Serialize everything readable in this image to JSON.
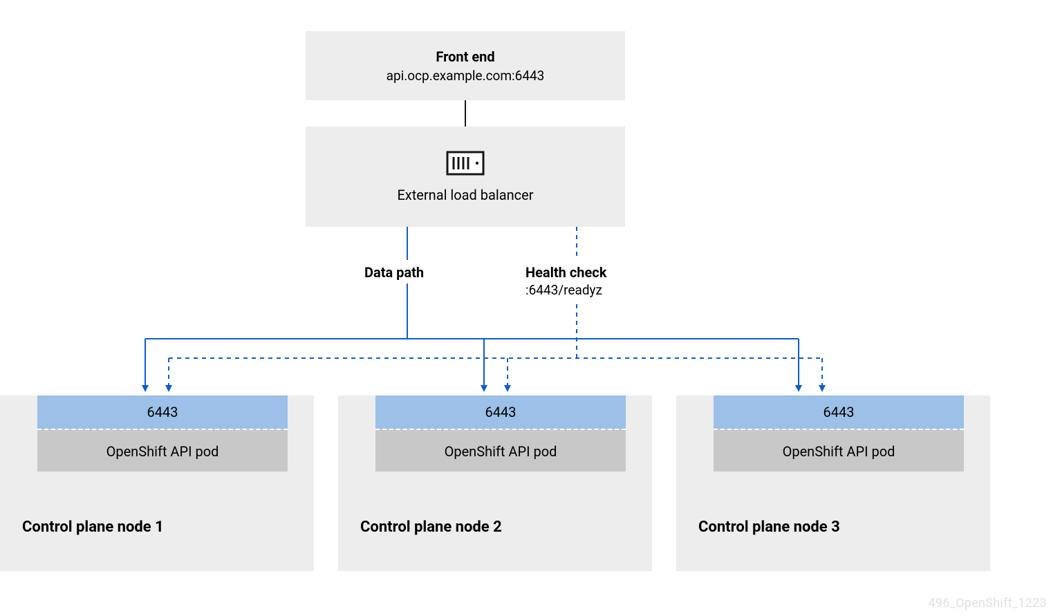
{
  "frontend": {
    "title": "Front end",
    "subtitle": "api.ocp.example.com:6443"
  },
  "loadbalancer": {
    "label": "External load balancer"
  },
  "datapath": {
    "title": "Data path"
  },
  "healthcheck": {
    "title": "Health check",
    "subtitle": ":6443/readyz"
  },
  "nodes": {
    "n1": {
      "port": "6443",
      "pod": "OpenShift API pod",
      "title": "Control plane node 1"
    },
    "n2": {
      "port": "6443",
      "pod": "OpenShift API pod",
      "title": "Control plane node 2"
    },
    "n3": {
      "port": "6443",
      "pod": "OpenShift API pod",
      "title": "Control plane node 3"
    }
  },
  "watermark": "496_OpenShift_1223"
}
